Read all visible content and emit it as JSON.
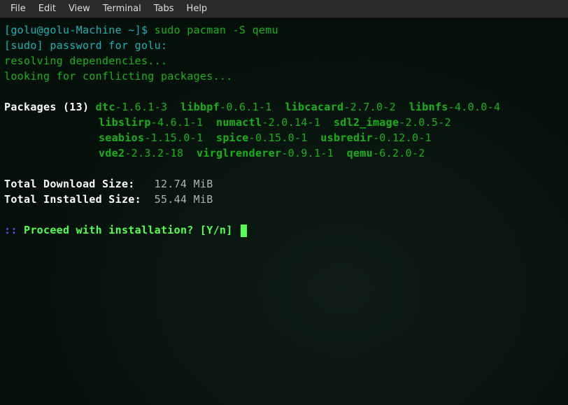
{
  "menubar": {
    "items": [
      "File",
      "Edit",
      "View",
      "Terminal",
      "Tabs",
      "Help"
    ]
  },
  "prompt": {
    "user_host": "[golu@golu-Machine ~]$ ",
    "command": "sudo pacman -S qemu"
  },
  "sudo_line": "[sudo] password for golu:",
  "resolving": "resolving dependencies...",
  "conflicting": "looking for conflicting packages...",
  "packages_label": "Packages (13)",
  "packages": [
    {
      "name": "dtc",
      "ver": "-1.6.1-3"
    },
    {
      "name": "libbpf",
      "ver": "-0.6.1-1"
    },
    {
      "name": "libcacard",
      "ver": "-2.7.0-2"
    },
    {
      "name": "libnfs",
      "ver": "-4.0.0-4"
    },
    {
      "name": "libslirp",
      "ver": "-4.6.1-1"
    },
    {
      "name": "numactl",
      "ver": "-2.0.14-1"
    },
    {
      "name": "sdl2_image",
      "ver": "-2.0.5-2"
    },
    {
      "name": "seabios",
      "ver": "-1.15.0-1"
    },
    {
      "name": "spice",
      "ver": "-0.15.0-1"
    },
    {
      "name": "usbredir",
      "ver": "-0.12.0-1"
    },
    {
      "name": "vde2",
      "ver": "-2.3.2-18"
    },
    {
      "name": "virglrenderer",
      "ver": "-0.9.1-1"
    },
    {
      "name": "qemu",
      "ver": "-6.2.0-2"
    }
  ],
  "download_label": "Total Download Size:   ",
  "download_value": "12.74 MiB",
  "installed_label": "Total Installed Size:  ",
  "installed_value": "55.44 MiB",
  "proceed_prefix": ":: ",
  "proceed_text": "Proceed with installation? [Y/n] "
}
